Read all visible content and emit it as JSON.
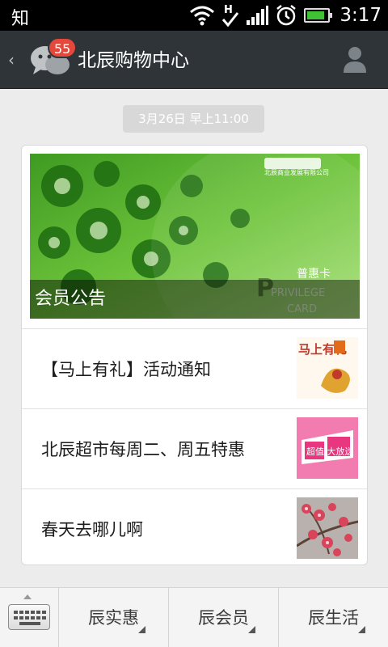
{
  "status_bar": {
    "app_char": "知",
    "time": "3:17",
    "icons": [
      "wifi-icon",
      "hsdpa-icon",
      "signal-icon",
      "alarm-icon",
      "battery-icon"
    ],
    "battery_level": 0.85
  },
  "header": {
    "back_icon": "chevron-left-icon",
    "chat_icon": "chat-bubbles-icon",
    "badge_count": "55",
    "title": "北辰购物中心",
    "profile_icon": "person-icon"
  },
  "message": {
    "timestamp": "3月26日 早上11:00",
    "hero": {
      "caption": "会员公告",
      "card_brand_small": "北辰商业发展有限公司",
      "card_label": "普惠卡",
      "card_word": "PRIVILEGE",
      "card_sub": "CARD"
    },
    "articles": [
      {
        "title": "【马上有礼】活动通知",
        "thumb_text": "马上有礼"
      },
      {
        "title": "北辰超市每周二、周五特惠",
        "thumb_text": "超值 大放送"
      },
      {
        "title": "春天去哪儿啊"
      }
    ]
  },
  "bottom_bar": {
    "keyboard_icon": "keyboard-icon",
    "menus": [
      {
        "label": "辰实惠"
      },
      {
        "label": "辰会员"
      },
      {
        "label": "辰生活"
      }
    ]
  },
  "colors": {
    "titlebar": "#2f3438",
    "badge": "#e5483b",
    "card_green": "#5fb52d",
    "background": "#ececec"
  }
}
